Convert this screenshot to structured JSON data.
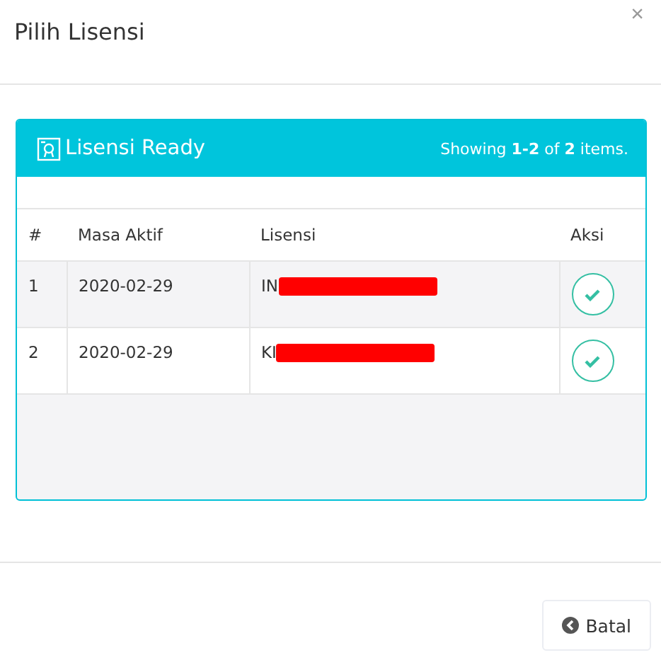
{
  "dialog": {
    "title": "Pilih Lisensi",
    "close": "×"
  },
  "panel": {
    "title": "Lisensi Ready",
    "summary": "Showing **1-2** of **2** items."
  },
  "table": {
    "columns": [
      "#",
      "Masa Aktif",
      "Lisensi",
      "Aksi"
    ],
    "rows": [
      {
        "no": "1",
        "masa_aktif": "2020-02-29",
        "lisensi": "IN",
        "redacted": true
      },
      {
        "no": "2",
        "masa_aktif": "2020-02-29",
        "lisensi": "KI",
        "redacted": true
      }
    ]
  },
  "buttons": [
    {
      "label": "Batal"
    }
  ]
}
